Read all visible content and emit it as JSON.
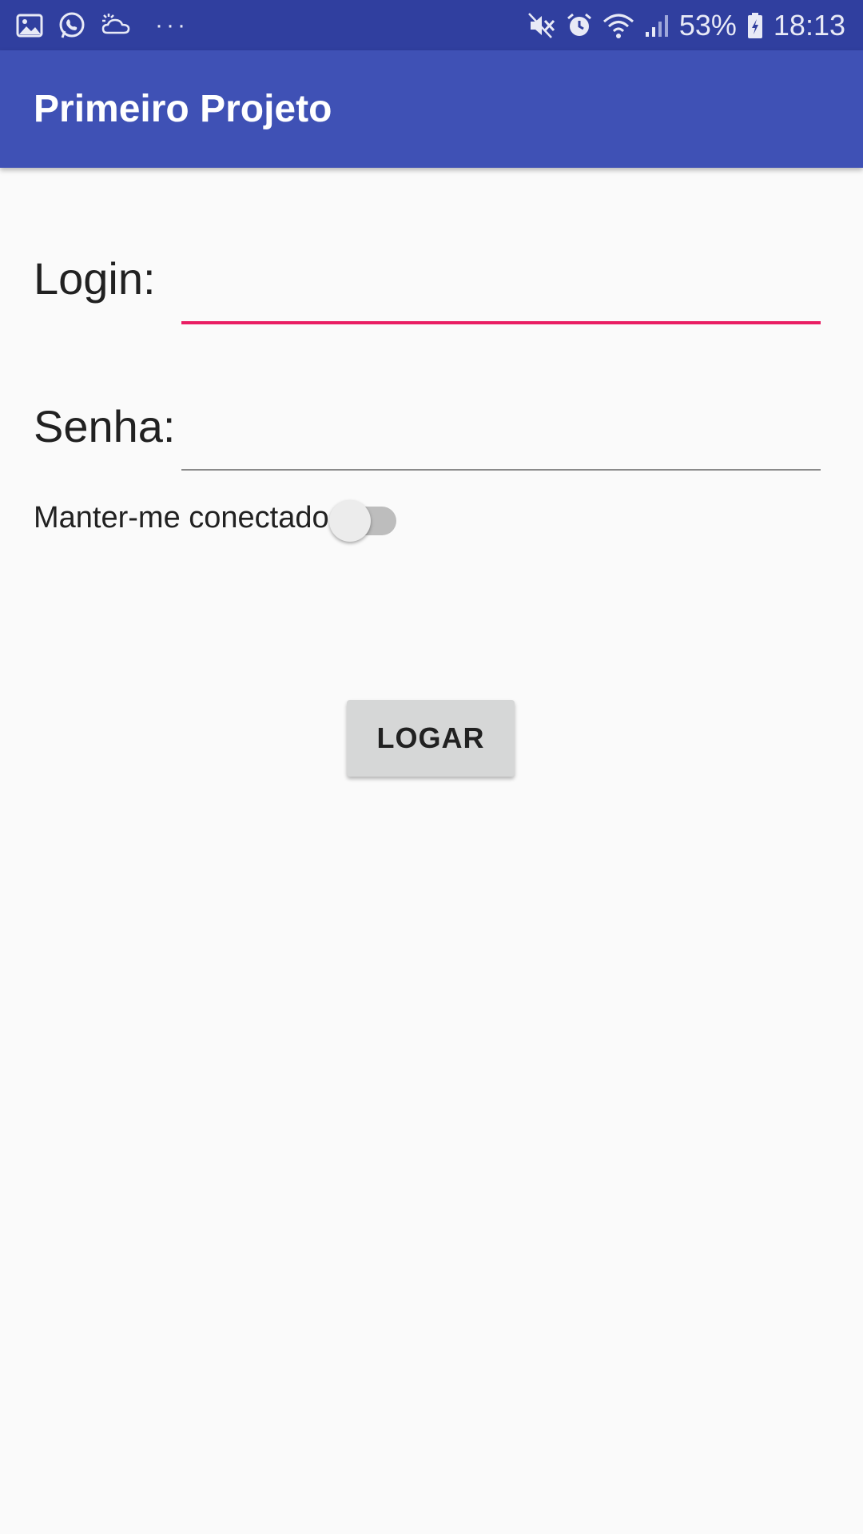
{
  "status_bar": {
    "left_icons": [
      "gallery-icon",
      "whatsapp-icon",
      "cloud-sun-icon"
    ],
    "more_notifications": "···",
    "right_icons": [
      "mute-icon",
      "alarm-icon",
      "wifi-icon",
      "signal-icon"
    ],
    "battery": "53%",
    "time": "18:13"
  },
  "app_bar": {
    "title": "Primeiro Projeto",
    "color": "#3f51b5"
  },
  "form": {
    "login_label": "Login:",
    "login_value": "",
    "senha_label": "Senha:",
    "senha_value": "",
    "keep_connected_label": "Manter-me conectado",
    "keep_connected_on": false,
    "submit_label": "LOGAR"
  },
  "colors": {
    "status_bar": "#303f9f",
    "accent": "#e91e63",
    "background": "#fafafa"
  }
}
